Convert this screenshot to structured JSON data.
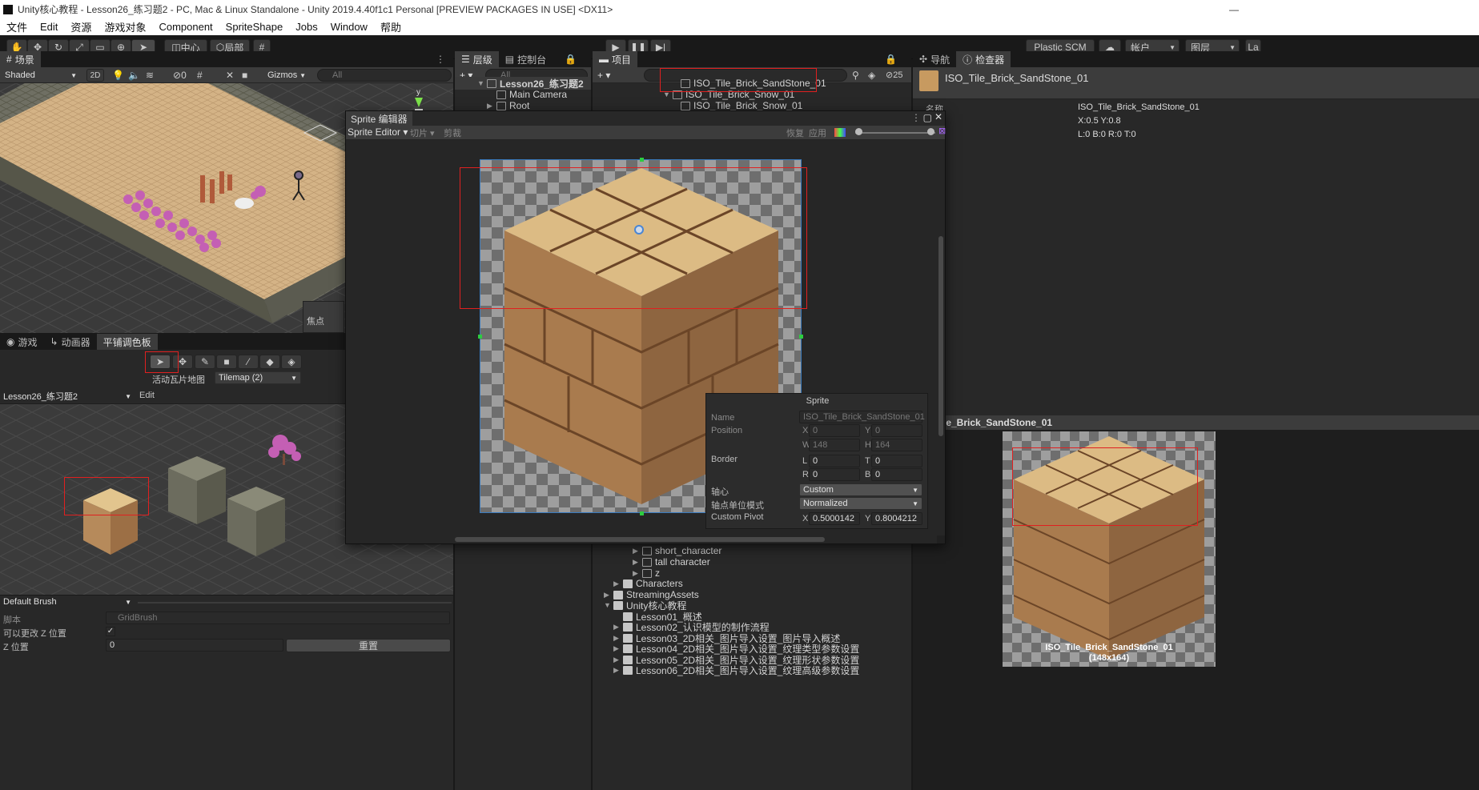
{
  "window": {
    "title": "Unity核心教程 - Lesson26_练习题2 - PC, Mac & Linux Standalone - Unity 2019.4.40f1c1 Personal [PREVIEW PACKAGES IN USE] <DX11>"
  },
  "menu": [
    "文件",
    "Edit",
    "资源",
    "游戏对象",
    "Component",
    "SpriteShape",
    "Jobs",
    "Window",
    "帮助"
  ],
  "toolbar": {
    "pivot_mode": "中心",
    "pivot_space": "局部",
    "plastic": "Plastic SCM",
    "account": "帐户",
    "layers": "图层",
    "layout": "La"
  },
  "scene": {
    "tab": "场景",
    "shading": "Shaded",
    "mode_2d": "2D",
    "hidden_count": "0",
    "gizmos": "Gizmos",
    "search_placeholder": "All",
    "focus_label": "焦点",
    "axis_y": "y"
  },
  "palette_tabs": {
    "game": "游戏",
    "animator": "动画器",
    "tile_palette": "平铺调色板"
  },
  "palette": {
    "active_tilemap_label": "活动瓦片地图",
    "active_tilemap": "Tilemap (2)",
    "palette_name": "Lesson26_练习题2",
    "edit": "Edit"
  },
  "brush": {
    "name": "Default Brush",
    "script_label": "脚本",
    "script_value": "GridBrush",
    "can_change_z_label": "可以更改 Z 位置",
    "z_label": "Z 位置",
    "z_value": "0",
    "reset": "重置"
  },
  "hierarchy": {
    "tab_layer": "层级",
    "tab_console": "控制台",
    "search_placeholder": "All",
    "scene_name": "Lesson26_练习题2",
    "items": [
      "Main Camera",
      "Root"
    ]
  },
  "project": {
    "tab": "项目",
    "hidden_count": "25",
    "top_items": [
      "ISO_Tile_Brick_SandStone_01",
      "ISO_Tile_Brick_Snow_01",
      "ISO_Tile_Brick_Snow_01"
    ],
    "bottom_items": [
      "short_character",
      "tall character",
      "z"
    ],
    "folders": [
      "Characters",
      "StreamingAssets",
      "Unity核心教程"
    ],
    "lessons": [
      "Lesson01_概述",
      "Lesson02_认识模型的制作流程",
      "Lesson03_2D相关_图片导入设置_图片导入概述",
      "Lesson04_2D相关_图片导入设置_纹理类型参数设置",
      "Lesson05_2D相关_图片导入设置_纹理形状参数设置",
      "Lesson06_2D相关_图片导入设置_纹理高级参数设置"
    ]
  },
  "sprite_editor": {
    "window_title": "Sprite 编辑器",
    "mode": "Sprite Editor",
    "slice": "切片",
    "trim": "剪裁",
    "revert": "恢复",
    "apply": "应用",
    "panel_title": "Sprite",
    "name_label": "Name",
    "name_value": "ISO_Tile_Brick_SandStone_01",
    "position_label": "Position",
    "x_label": "X",
    "x_value": "0",
    "y_label": "Y",
    "y_value": "0",
    "w_label": "W",
    "w_value": "148",
    "h_label": "H",
    "h_value": "164",
    "border_label": "Border",
    "l_label": "L",
    "l_value": "0",
    "t_label": "T",
    "t_value": "0",
    "r_label": "R",
    "r_value": "0",
    "b_label": "B",
    "b_value": "0",
    "pivot_label": "轴心",
    "pivot_value": "Custom",
    "pivot_unit_label": "轴点单位模式",
    "pivot_unit_value": "Normalized",
    "custom_pivot_label": "Custom Pivot",
    "px_label": "X",
    "px_value": "0.5000142",
    "py_label": "Y",
    "py_value": "0.8004212"
  },
  "inspector": {
    "tab_nav": "导航",
    "tab_inspector": "检查器",
    "asset_name": "ISO_Tile_Brick_SandStone_01",
    "name_label": "名称",
    "name_value": "ISO_Tile_Brick_SandStone_01",
    "pivot_text": "X:0.5 Y:0.8",
    "border_text": "L:0 B:0 R:0 T:0",
    "preview_header": "le_Brick_SandStone_01",
    "preview_caption": "ISO_Tile_Brick_SandStone_01",
    "preview_size": "(148x164)"
  }
}
